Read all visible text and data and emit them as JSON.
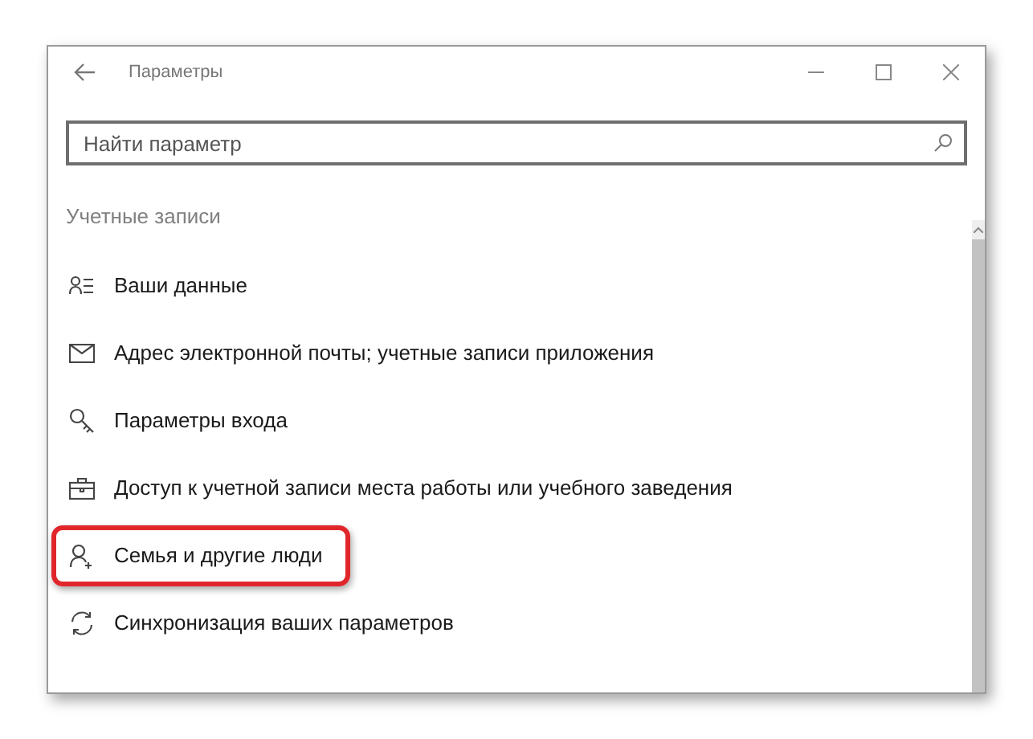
{
  "window": {
    "title": "Параметры"
  },
  "search": {
    "placeholder": "Найти параметр"
  },
  "section_title": "Учетные записи",
  "items": [
    {
      "kind": "person-list",
      "label": "Ваши данные",
      "highlighted": false
    },
    {
      "kind": "mail",
      "label": "Адрес электронной почты; учетные записи приложения",
      "highlighted": false
    },
    {
      "kind": "key",
      "label": "Параметры входа",
      "highlighted": false
    },
    {
      "kind": "briefcase",
      "label": "Доступ к учетной записи места работы или учебного заведения",
      "highlighted": false
    },
    {
      "kind": "person-add",
      "label": "Семья и другие люди",
      "highlighted": true
    },
    {
      "kind": "sync",
      "label": "Синхронизация ваших параметров",
      "highlighted": false
    }
  ]
}
